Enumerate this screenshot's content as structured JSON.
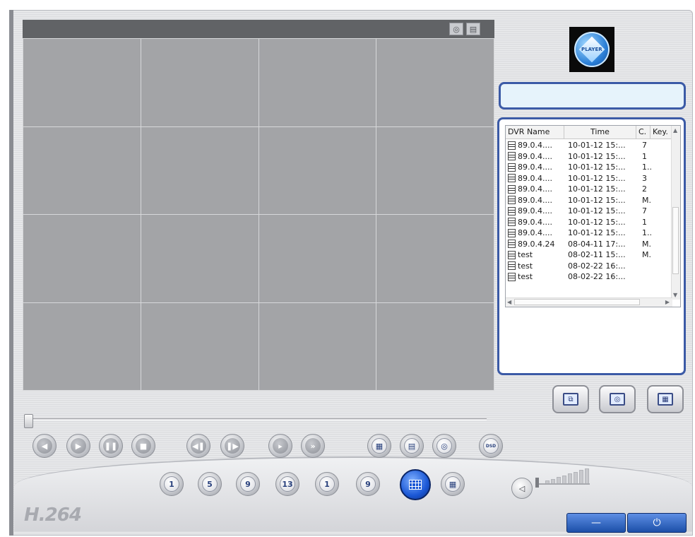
{
  "video": {
    "toolbar_icons": [
      "camera-icon",
      "print-icon"
    ],
    "grid_cells": 16
  },
  "logo": {
    "text": "PLAYER"
  },
  "list": {
    "headers": [
      "DVR Name",
      "Time",
      "C.",
      "Key."
    ],
    "rows": [
      {
        "name": "89.0.4....",
        "time": "10-01-12 15:...",
        "ch": "7"
      },
      {
        "name": "89.0.4....",
        "time": "10-01-12 15:...",
        "ch": "1"
      },
      {
        "name": "89.0.4....",
        "time": "10-01-12 15:...",
        "ch": "1.."
      },
      {
        "name": "89.0.4....",
        "time": "10-01-12 15:...",
        "ch": "3"
      },
      {
        "name": "89.0.4....",
        "time": "10-01-12 15:...",
        "ch": "2"
      },
      {
        "name": "89.0.4....",
        "time": "10-01-12 15:...",
        "ch": "M."
      },
      {
        "name": "89.0.4....",
        "time": "10-01-12 15:...",
        "ch": "7"
      },
      {
        "name": "89.0.4....",
        "time": "10-01-12 15:...",
        "ch": "1"
      },
      {
        "name": "89.0.4....",
        "time": "10-01-12 15:...",
        "ch": "1.."
      },
      {
        "name": "89.0.4.24",
        "time": "08-04-11 17:...",
        "ch": "M."
      },
      {
        "name": "test",
        "time": "08-02-11 15:...",
        "ch": "M."
      },
      {
        "name": "test",
        "time": "08-02-22 16:...",
        "ch": ""
      },
      {
        "name": "test",
        "time": "08-02-22 16:...",
        "ch": ""
      }
    ]
  },
  "playback": {
    "buttons": [
      "rewind",
      "play",
      "pause",
      "stop",
      "step-back",
      "step-forward",
      "slow",
      "fast",
      "export-clip",
      "print",
      "snapshot",
      "dsd"
    ],
    "dsd_label": "DSD"
  },
  "layout_buttons": [
    "1",
    "5",
    "9",
    "13",
    "1",
    "9",
    "16",
    "sequence"
  ],
  "volume_level": 0,
  "brand": {
    "h264": "H.264"
  },
  "window": {
    "minimize_label": "—",
    "power_label": "⏻"
  }
}
